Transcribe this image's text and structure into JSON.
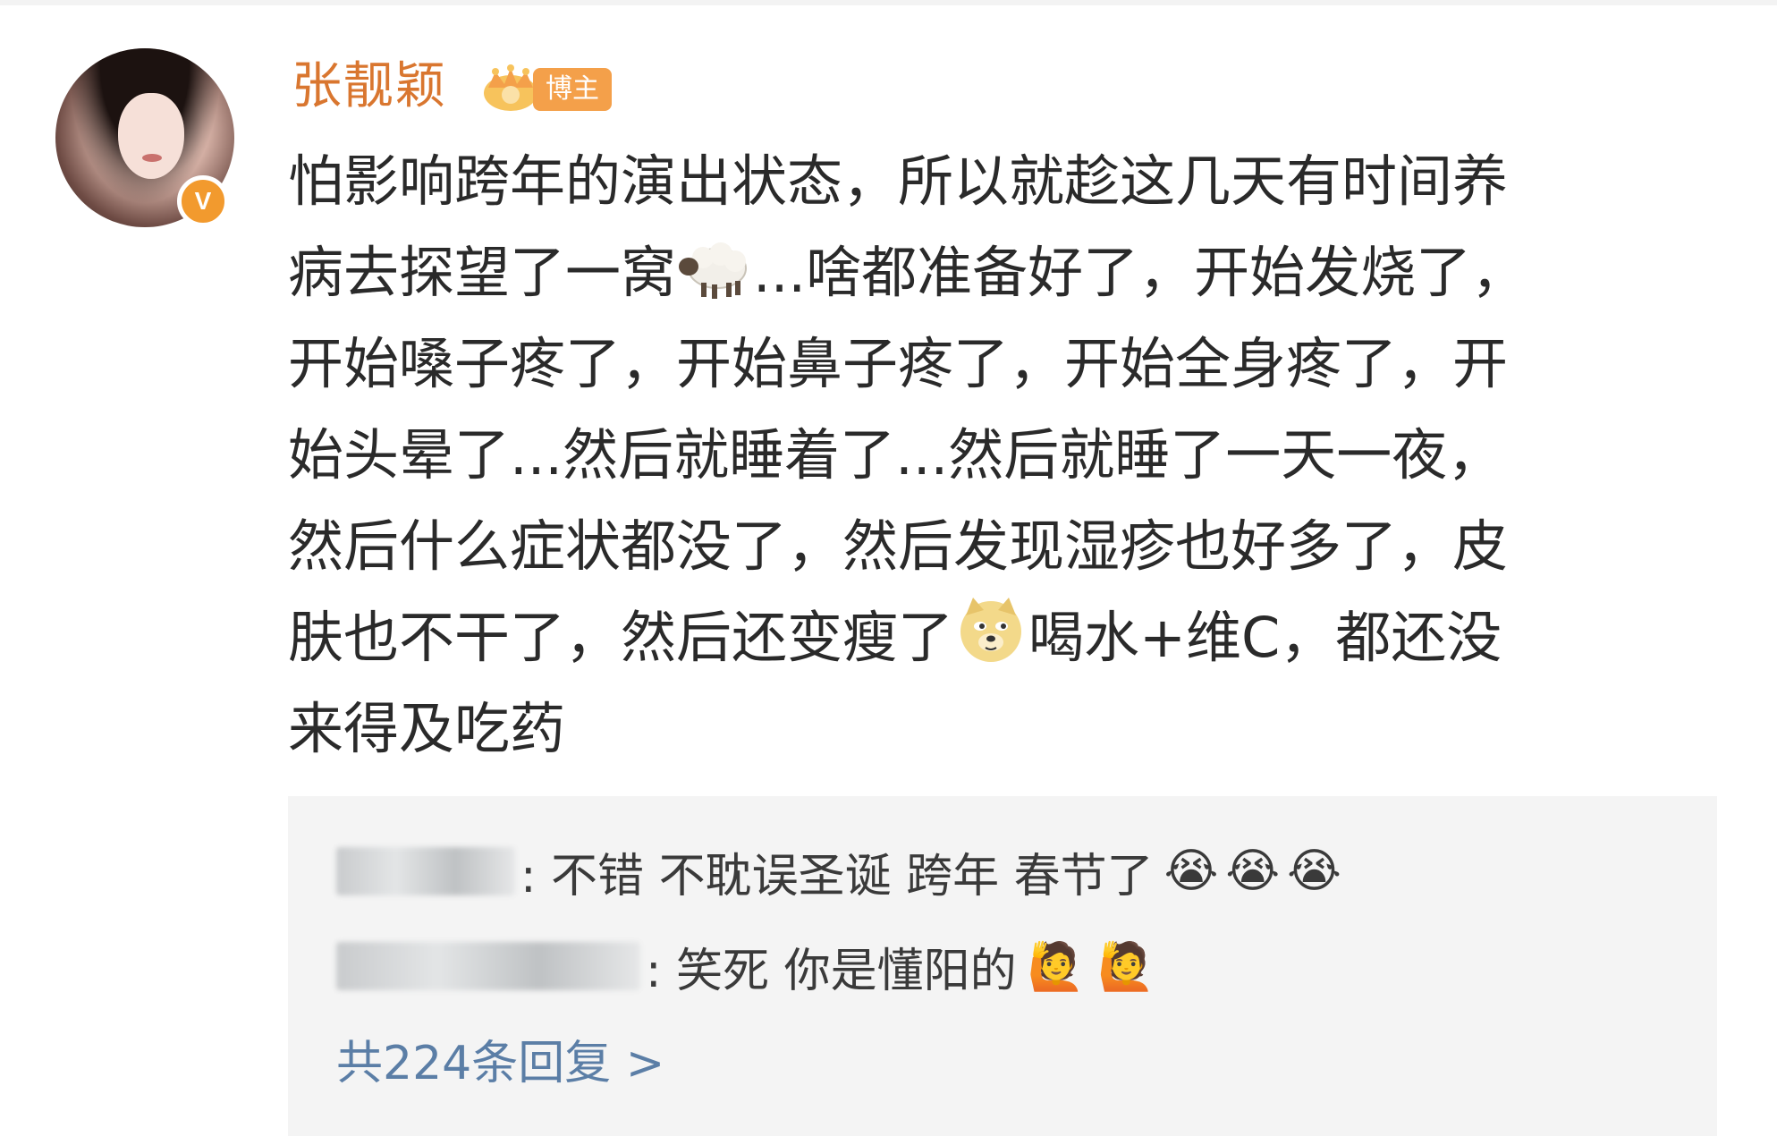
{
  "post": {
    "username": "张靓颖",
    "badge_label": "博主",
    "verified_badge": "V",
    "text_lines": [
      "怕影响跨年的演出状态，所以就趁这几天有时间养",
      "病去探望了一窝",
      "...啥都准备好了，开始发烧了，",
      "开始嗓子疼了，开始鼻子疼了，开始全身疼了，开",
      "始头晕了...然后就睡着了...然后就睡了一天一夜，",
      "然后什么症状都没了，然后发现湿疹也好多了，皮",
      "肤也不干了，然后还变瘦了",
      "喝水+维C，都还没",
      "来得及吃药"
    ],
    "emoji_sheep": "🐑",
    "emoji_doge": "doge"
  },
  "replies": {
    "items": [
      {
        "text": ": 不错 不耽误圣诞 跨年 春节了",
        "emojis": [
          "😭",
          "😭",
          "😭"
        ]
      },
      {
        "text": ": 笑死 你是懂阳的",
        "emojis": [
          "🙋",
          "🙋"
        ]
      }
    ],
    "more_label": "共224条回复 >"
  },
  "colors": {
    "username": "#d9762f",
    "badge": "#f4a04a",
    "verified": "#f29a2e",
    "link": "#5b7ea6",
    "reply_bg": "#f4f4f4"
  }
}
